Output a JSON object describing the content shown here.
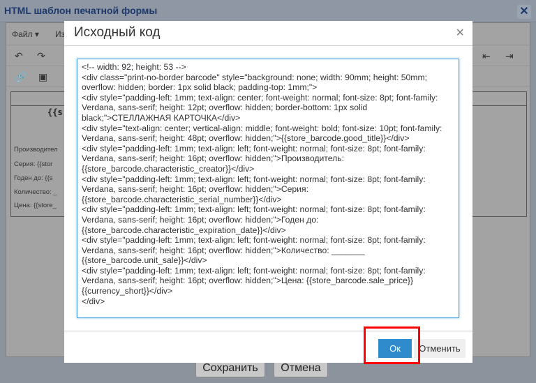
{
  "window": {
    "title": "HTML шаблон печатной формы",
    "close": "✕"
  },
  "editor": {
    "menu": {
      "file": "Файл ▾",
      "edit": "Из"
    },
    "doc": {
      "title": "{{s",
      "fields": [
        "Производител",
        "Серия: {{stor",
        "Годен до: {{s",
        "Количество: _",
        "Цена: {{store_"
      ]
    }
  },
  "footer": {
    "save": "Сохранить",
    "cancel": "Отмена"
  },
  "dialog": {
    "title": "Исходный код",
    "close": "×",
    "source": "<!-- width: 92; height: 53 -->\n<div class=\"print-no-border barcode\" style=\"background: none; width: 90mm; height: 50mm; overflow: hidden; border: 1px solid black; padding-top: 1mm;\">\n<div style=\"padding-left: 1mm; text-align: center; font-weight: normal; font-size: 8pt; font-family: Verdana, sans-serif; height: 12pt; overflow: hidden; border-bottom: 1px solid black;\">СТЕЛЛАЖНАЯ КАРТОЧКА</div>\n<div style=\"text-align: center; vertical-align: middle; font-weight: bold; font-size: 10pt; font-family: Verdana, sans-serif; height: 48pt; overflow: hidden;\">{{store_barcode.good_title}}</div>\n<div style=\"padding-left: 1mm; text-align: left; font-weight: normal; font-size: 8pt; font-family: Verdana, sans-serif; height: 16pt; overflow: hidden;\">Производитель: {{store_barcode.characteristic_creator}}</div>\n<div style=\"padding-left: 1mm; text-align: left; font-weight: normal; font-size: 8pt; font-family: Verdana, sans-serif; height: 16pt; overflow: hidden;\">Серия: {{store_barcode.characteristic_serial_number}}</div>\n<div style=\"padding-left: 1mm; text-align: left; font-weight: normal; font-size: 8pt; font-family: Verdana, sans-serif; height: 16pt; overflow: hidden;\">Годен до: {{store_barcode.characteristic_expiration_date}}</div>\n<div style=\"padding-left: 1mm; text-align: left; font-weight: normal; font-size: 8pt; font-family: Verdana, sans-serif; height: 16pt; overflow: hidden;\">Количество: _______ {{store_barcode.unit_sale}}</div>\n<div style=\"padding-left: 1mm; text-align: left; font-weight: normal; font-size: 8pt; font-family: Verdana, sans-serif; height: 16pt; overflow: hidden;\">Цена: {{store_barcode.sale_price}} {{currency_short}}</div>\n</div>",
    "ok": "Ок",
    "cancel": "Отменить"
  }
}
